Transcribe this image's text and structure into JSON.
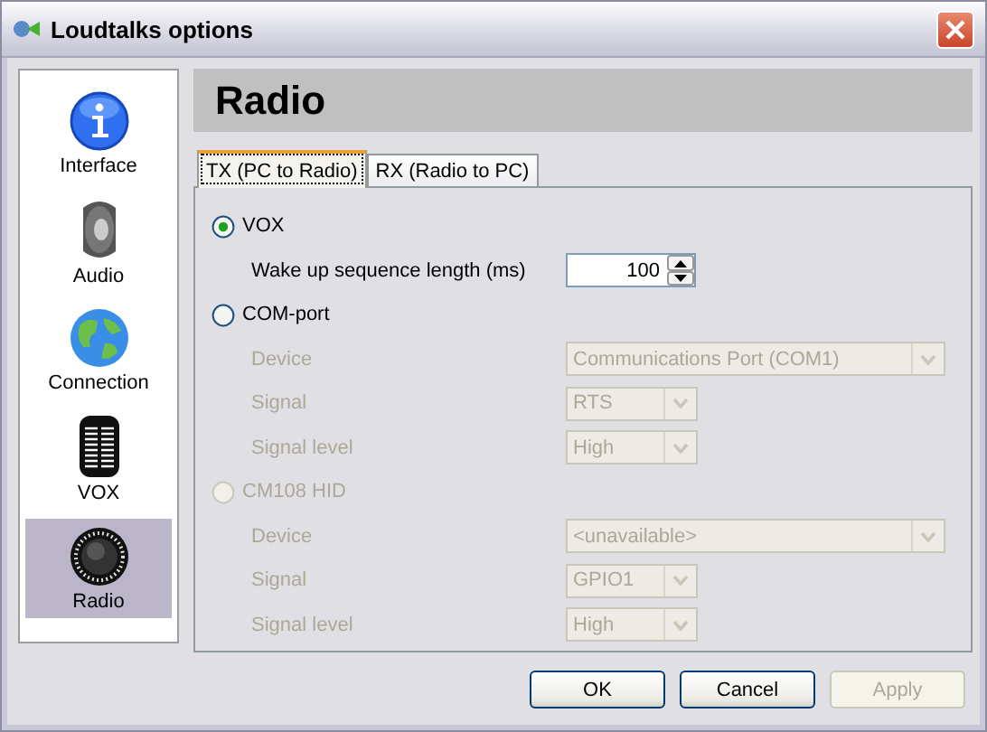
{
  "window": {
    "title": "Loudtalks options"
  },
  "sidebar": {
    "items": [
      {
        "label": "Interface",
        "selected": false
      },
      {
        "label": "Audio",
        "selected": false
      },
      {
        "label": "Connection",
        "selected": false
      },
      {
        "label": "VOX",
        "selected": false
      },
      {
        "label": "Radio",
        "selected": true
      }
    ]
  },
  "header": {
    "title": "Radio"
  },
  "tabs": [
    {
      "label": "TX (PC to Radio)",
      "selected": true
    },
    {
      "label": "RX (Radio to PC)",
      "selected": false
    }
  ],
  "modes": [
    {
      "label": "VOX",
      "selected": true,
      "disabled": false,
      "fields": [
        {
          "kind": "spin",
          "label": "Wake up sequence length (ms)",
          "value": "100",
          "disabled": false
        }
      ]
    },
    {
      "label": "COM-port",
      "selected": false,
      "disabled": false,
      "fields": [
        {
          "kind": "wide-combo",
          "label": "Device",
          "value": "Communications Port (COM1)",
          "disabled": true
        },
        {
          "kind": "combo",
          "label": "Signal",
          "value": "RTS",
          "disabled": true
        },
        {
          "kind": "combo",
          "label": "Signal level",
          "value": "High",
          "disabled": true
        }
      ]
    },
    {
      "label": "CM108 HID",
      "selected": false,
      "disabled": true,
      "fields": [
        {
          "kind": "wide-combo",
          "label": "Device",
          "value": "<unavailable>",
          "disabled": true
        },
        {
          "kind": "combo",
          "label": "Signal",
          "value": "GPIO1",
          "disabled": true
        },
        {
          "kind": "combo",
          "label": "Signal level",
          "value": "High",
          "disabled": true
        }
      ]
    }
  ],
  "buttons": [
    {
      "label": "OK",
      "disabled": false
    },
    {
      "label": "Cancel",
      "disabled": false
    },
    {
      "label": "Apply",
      "disabled": true
    }
  ]
}
